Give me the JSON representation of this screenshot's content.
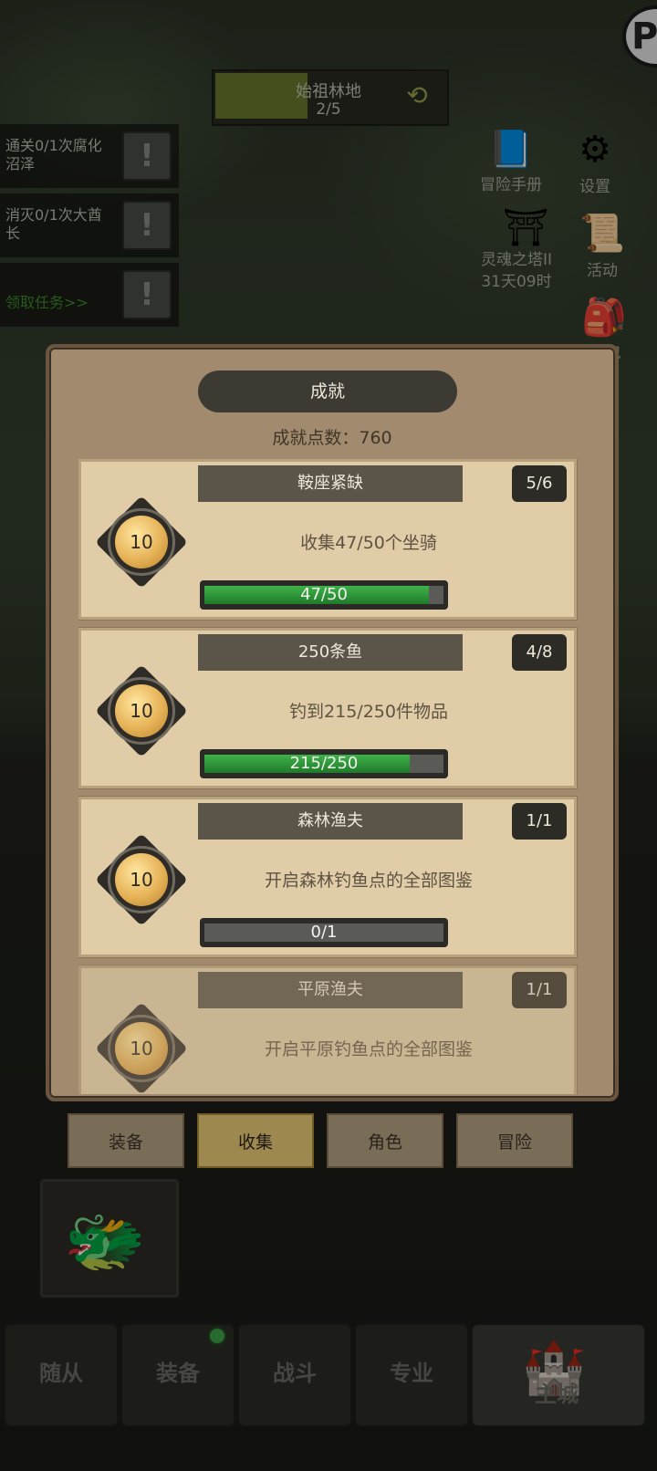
{
  "zone": {
    "name": "始祖林地",
    "progress": "2/5",
    "fill_fraction": 0.4
  },
  "quests": [
    {
      "text": "通关0/1次腐化沼泽"
    },
    {
      "text": "消灭0/1次大酋长"
    }
  ],
  "quest_link": "领取任务>>",
  "side_menu": {
    "handbook": "冒险手册",
    "settings": "设置",
    "tower": "灵魂之塔II",
    "tower_time": "31天09时",
    "activity": "活动",
    "bag": "包"
  },
  "dialog": {
    "title": "成就",
    "points_label": "成就点数：760"
  },
  "achievements": [
    {
      "name": "鞍座紧缺",
      "count": "5/6",
      "points": "10",
      "desc": "收集47/50个坐骑",
      "progress_text": "47/50",
      "progress": 0.94
    },
    {
      "name": "250条鱼",
      "count": "4/8",
      "points": "10",
      "desc": "钓到215/250件物品",
      "progress_text": "215/250",
      "progress": 0.86
    },
    {
      "name": "森林渔夫",
      "count": "1/1",
      "points": "10",
      "desc": "开启森林钓鱼点的全部图鉴",
      "progress_text": "0/1",
      "progress": 0.0
    },
    {
      "name": "平原渔夫",
      "count": "1/1",
      "points": "10",
      "desc": "开启平原钓鱼点的全部图鉴",
      "progress_text": "",
      "progress": 0.0
    }
  ],
  "filter_tabs": [
    "装备",
    "收集",
    "角色",
    "冒险"
  ],
  "bottom_nav": [
    "随从",
    "装备",
    "战斗",
    "专业",
    "主城"
  ],
  "colors": {
    "progress_green": "#2f9a3a",
    "active_tab": "#f2d27a",
    "dialog_bg": "#a18a6d"
  }
}
